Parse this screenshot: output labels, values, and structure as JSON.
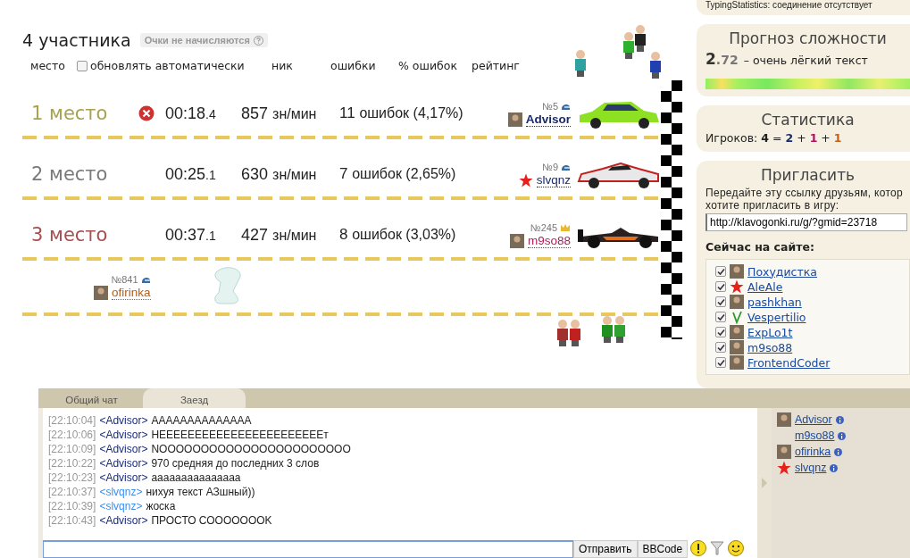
{
  "race": {
    "title": "4 участника",
    "badge": "Очки не начисляются",
    "header": {
      "place": "место",
      "auto_update": {
        "label": "обновлять автоматически",
        "checked": false
      },
      "columns": [
        "ник",
        "ошибки",
        "% ошибок",
        "рейтинг"
      ]
    },
    "rows": [
      {
        "kind": "finished",
        "place": "1 место",
        "color": "#a8a24e",
        "error_icon": true,
        "time": "00:18",
        "time_tenths": ".4",
        "speed": "857",
        "speed_unit": "зн/мин",
        "errors_count": "11",
        "errors": "ошибок (4,17%)",
        "player": {
          "number": "№5",
          "badge": {
            "kind": "helmet"
          },
          "avatar": {
            "kind": "photo"
          },
          "name": "Advisor",
          "color": "#1a2a6c",
          "bold": true
        },
        "car": {
          "kind": "sedan"
        }
      },
      {
        "kind": "finished",
        "place": "2 место",
        "color": "#7a7a7a",
        "error_icon": false,
        "time": "00:25",
        "time_tenths": ".1",
        "speed": "630",
        "speed_unit": "зн/мин",
        "errors_count": "7",
        "errors": "ошибок (2,65%)",
        "player": {
          "number": "№9",
          "badge": {
            "kind": "helmet"
          },
          "avatar": {
            "kind": "star"
          },
          "name": "slvqnz",
          "color": "#1a2a6c",
          "bold": false
        },
        "car": {
          "kind": "sports"
        }
      },
      {
        "kind": "finished",
        "place": "3 место",
        "color": "#a84e4e",
        "error_icon": false,
        "time": "00:37",
        "time_tenths": ".1",
        "speed": "427",
        "speed_unit": "зн/мин",
        "errors_count": "8",
        "errors": "ошибок (3,03%)",
        "player": {
          "number": "№245",
          "badge": {
            "kind": "crown"
          },
          "avatar": {
            "kind": "photo"
          },
          "name": "m9so88",
          "color": "#b0205a",
          "bold": false
        },
        "car": {
          "kind": "formula"
        }
      },
      {
        "kind": "unfinished",
        "player": {
          "number": "№841",
          "badge": {
            "kind": "helmet"
          },
          "avatar": {
            "kind": "photo"
          },
          "name": "ofirinka",
          "color": "#b0601a",
          "bold": false
        },
        "car": {
          "kind": "pod"
        }
      }
    ]
  },
  "sidebar": {
    "typing_statistics": {
      "label": "TypingStatistics:",
      "value": "соединение отсутствует"
    },
    "difficulty": {
      "title": "Прогноз сложности",
      "score_int": "2",
      "score_frac": ".72",
      "description": "– очень лёгкий текст"
    },
    "statistics": {
      "title": "Статистика",
      "label": "Игроков:",
      "total": "4",
      "equals": "=",
      "plus": "+",
      "parts": [
        {
          "value": "2",
          "color": "#1a2a6c"
        },
        {
          "value": "1",
          "color": "#b0105a"
        },
        {
          "value": "1",
          "color": "#c0601a"
        }
      ]
    },
    "invite": {
      "title": "Пригласить",
      "text_line_1": "Передайте эту ссылку друзьям, котор",
      "text_line_2": "хотите пригласить в игру:",
      "link": "http://klavogonki.ru/g/?gmid=23718"
    },
    "online": {
      "title": "Сейчас на сайте:",
      "users": [
        {
          "name": "Похудистка",
          "avatar": {
            "kind": "photo"
          },
          "checked": true
        },
        {
          "name": "AleAle",
          "avatar": {
            "kind": "star"
          },
          "checked": true
        },
        {
          "name": "pashkhan",
          "avatar": {
            "kind": "photo"
          },
          "checked": true
        },
        {
          "name": "Vespertilio",
          "avatar": {
            "kind": "sprout"
          },
          "checked": true
        },
        {
          "name": "ExpLo1t",
          "avatar": {
            "kind": "photo"
          },
          "checked": true
        },
        {
          "name": "m9so88",
          "avatar": {
            "kind": "photo"
          },
          "checked": true
        },
        {
          "name": "FrontendCoder",
          "avatar": {
            "kind": "photo"
          },
          "checked": true
        }
      ]
    }
  },
  "chat": {
    "tabs": [
      {
        "label": "Общий чат",
        "selected": false
      },
      {
        "label": "Заезд",
        "selected": true
      }
    ],
    "messages": [
      {
        "time": "[22:10:04]",
        "author": {
          "name": "<Advisor>",
          "color": "#1a2a7c"
        },
        "text": "AAAAAAAAAAAAAA"
      },
      {
        "time": "[22:10:06]",
        "author": {
          "name": "<Advisor>",
          "color": "#1a2a7c"
        },
        "text": "HEEEEEEEEEEEEEEEEEEEEEEEт"
      },
      {
        "time": "[22:10:09]",
        "author": {
          "name": "<Advisor>",
          "color": "#1a2a7c"
        },
        "text": "NOOOOOOOOOOOOOOOOOOOOOOO"
      },
      {
        "time": "[22:10:22]",
        "author": {
          "name": "<Advisor>",
          "color": "#1a2a7c"
        },
        "text": "970 средняя до последних 3 слов"
      },
      {
        "time": "[22:10:23]",
        "author": {
          "name": "<Advisor>",
          "color": "#1a2a7c"
        },
        "text": "ааааааааааааааа"
      },
      {
        "time": "[22:10:37]",
        "author": {
          "name": "<slvqnz>",
          "color": "#3a8ef0"
        },
        "text": "нихуя текст АЗшный))"
      },
      {
        "time": "[22:10:39]",
        "author": {
          "name": "<slvqnz>",
          "color": "#3a8ef0"
        },
        "text": "жоска"
      },
      {
        "time": "[22:10:43]",
        "author": {
          "name": "<Advisor>",
          "color": "#1a2a7c"
        },
        "text": "ПРОСТО СОООOOOOK"
      }
    ],
    "send_button": "Отправить",
    "bbcode_button": "BBCode",
    "users": [
      {
        "name": "Advisor",
        "avatar": {
          "kind": "photo"
        }
      },
      {
        "name": "m9so88",
        "avatar": {
          "kind": "none"
        }
      },
      {
        "name": "ofirinka",
        "avatar": {
          "kind": "photo"
        }
      },
      {
        "name": "slvqnz",
        "avatar": {
          "kind": "star"
        }
      }
    ]
  }
}
